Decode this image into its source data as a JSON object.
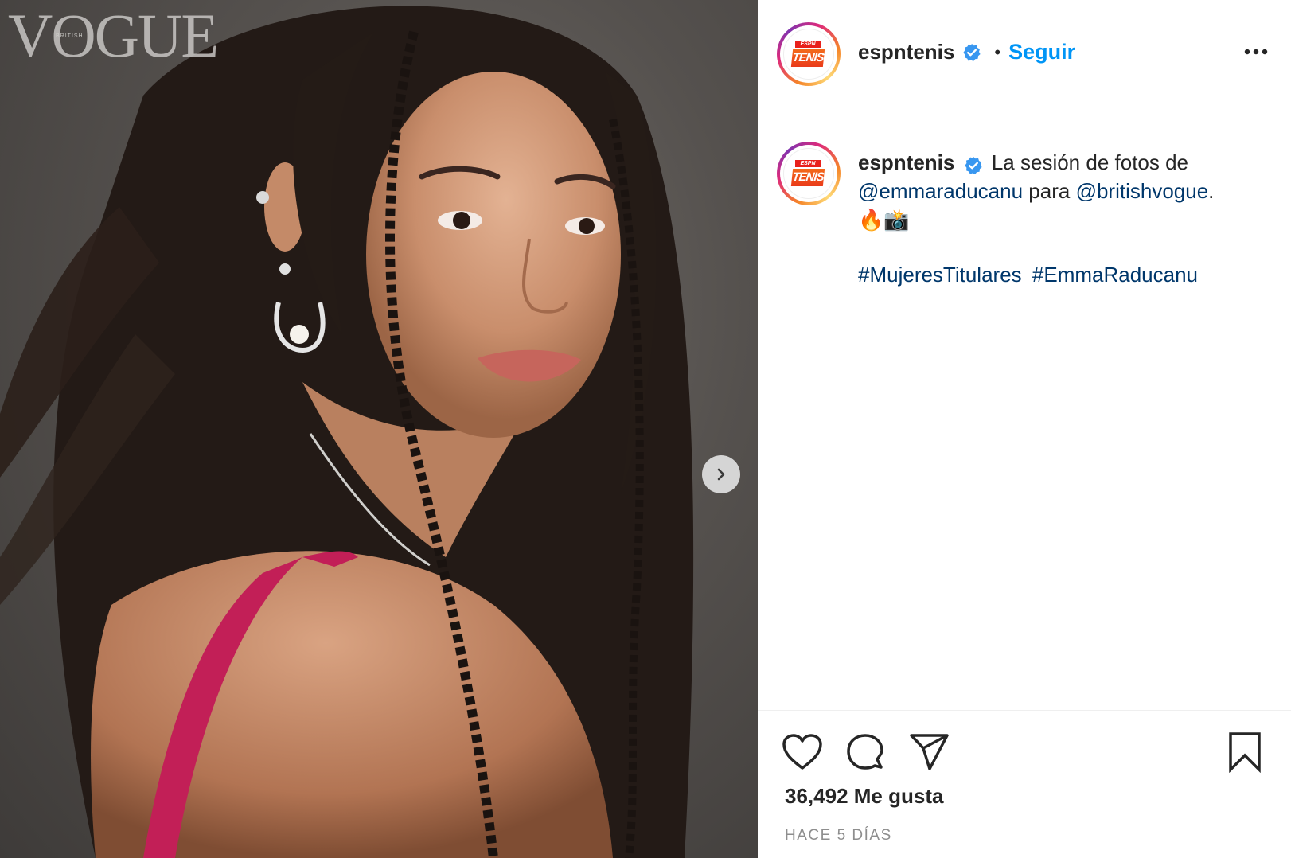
{
  "photo": {
    "watermark": "VOGUE",
    "watermark_sub": "BRITISH",
    "next_icon": "chevron-right-icon"
  },
  "header": {
    "username": "espntenis",
    "separator": "•",
    "follow_label": "Seguir",
    "avatar_logo_top": "ESPN",
    "avatar_logo_main": "TENIS",
    "more_icon": "more-options-icon"
  },
  "caption": {
    "username": "espntenis",
    "text_1": "La sesión de fotos de",
    "mention_1": "@emmaraducanu",
    "text_2": "para",
    "mention_2": "@britishvogue",
    "text_3": ".",
    "emojis": "🔥📸",
    "hashtags": [
      "#MujeresTitulares",
      "#EmmaRaducanu"
    ]
  },
  "actions": {
    "like_icon": "heart-icon",
    "comment_icon": "comment-icon",
    "share_icon": "send-icon",
    "save_icon": "bookmark-icon",
    "likes_text": "36,492 Me gusta",
    "time_ago": "HACE 5 DÍAS"
  },
  "colors": {
    "follow_blue": "#0095f6",
    "link_blue": "#00376b",
    "verified_blue": "#3897f0",
    "muted_gray": "#8e8e8e"
  }
}
